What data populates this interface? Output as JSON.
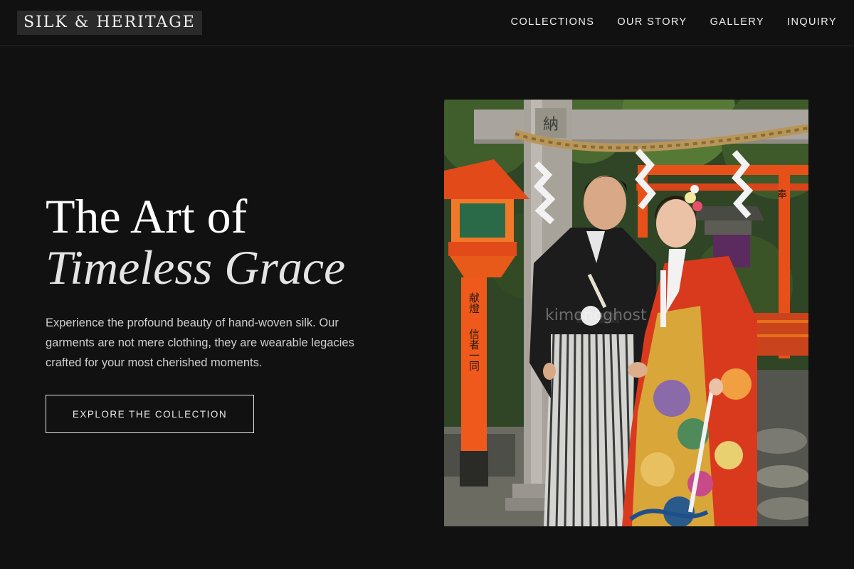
{
  "brand": {
    "logo_text": "SILK & HERITAGE"
  },
  "nav": {
    "items": [
      {
        "label": "COLLECTIONS"
      },
      {
        "label": "OUR STORY"
      },
      {
        "label": "GALLERY"
      },
      {
        "label": "INQUIRY"
      }
    ]
  },
  "hero": {
    "headline_line1": "The Art of",
    "headline_line2": "Timeless Grace",
    "tagline": "Experience the profound beauty of hand-woven silk. Our garments are not mere clothing, they are wearable legacies crafted for your most cherished moments.",
    "cta_label": "EXPLORE THE COLLECTION"
  },
  "photo": {
    "gate_plaque_text": "納",
    "watermark": "kimonoghost",
    "lantern_text": "献燈",
    "pillar_text": "信者一同",
    "right_pillar_text": "奉"
  },
  "colors": {
    "background": "#111111",
    "text": "#e8e8e8",
    "logo_bg": "#2a2a2a",
    "button_border": "#e6e6e6",
    "shrine_vermilion": "#e8501a"
  }
}
